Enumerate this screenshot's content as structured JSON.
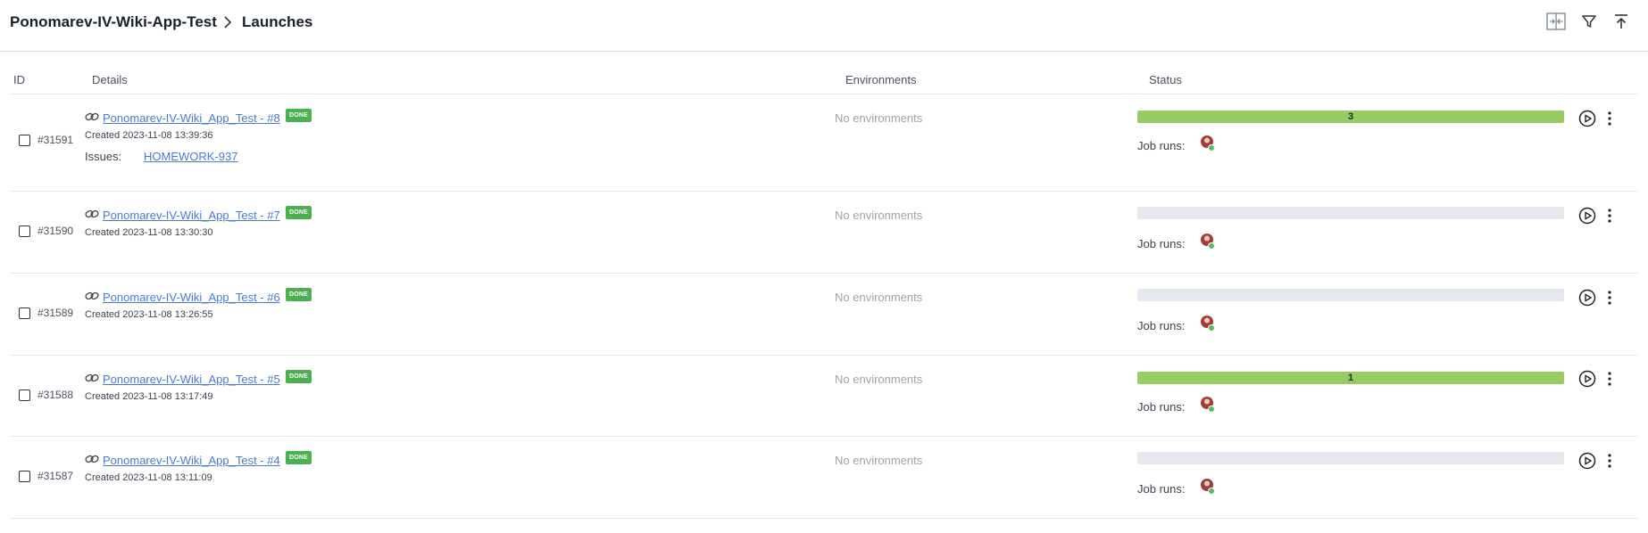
{
  "header": {
    "project": "Ponomarev-IV-Wiki-App-Test",
    "page": "Launches"
  },
  "table": {
    "columns": [
      "ID",
      "Details",
      "Environments",
      "Status"
    ]
  },
  "colors": {
    "accent_link": "#4a7bd1",
    "done_badge": "#4caf50",
    "progress_fill": "#96cc64",
    "progress_empty": "#e4e7ee"
  },
  "rows": [
    {
      "id": "#31591",
      "name": "Ponomarev-IV-Wiki_App_Test - #8",
      "status_badge": "DONE",
      "created": "Created 2023-11-08 13:39:36",
      "issues_label": "Issues:",
      "issue": "HOMEWORK-937",
      "environments": "No environments",
      "bar_label": "3",
      "bar_fraction": 1,
      "job_runs_label": "Job runs:"
    },
    {
      "id": "#31590",
      "name": "Ponomarev-IV-Wiki_App_Test - #7",
      "status_badge": "DONE",
      "created": "Created 2023-11-08 13:30:30",
      "environments": "No environments",
      "bar_label": "",
      "bar_fraction": 0,
      "job_runs_label": "Job runs:"
    },
    {
      "id": "#31589",
      "name": "Ponomarev-IV-Wiki_App_Test - #6",
      "status_badge": "DONE",
      "created": "Created 2023-11-08 13:26:55",
      "environments": "No environments",
      "bar_label": "",
      "bar_fraction": 0,
      "job_runs_label": "Job runs:"
    },
    {
      "id": "#31588",
      "name": "Ponomarev-IV-Wiki_App_Test - #5",
      "status_badge": "DONE",
      "created": "Created 2023-11-08 13:17:49",
      "environments": "No environments",
      "bar_label": "1",
      "bar_fraction": 1,
      "job_runs_label": "Job runs:"
    },
    {
      "id": "#31587",
      "name": "Ponomarev-IV-Wiki_App_Test - #4",
      "status_badge": "DONE",
      "created": "Created 2023-11-08 13:11:09",
      "environments": "No environments",
      "bar_label": "",
      "bar_fraction": 0,
      "job_runs_label": "Job runs:"
    }
  ]
}
